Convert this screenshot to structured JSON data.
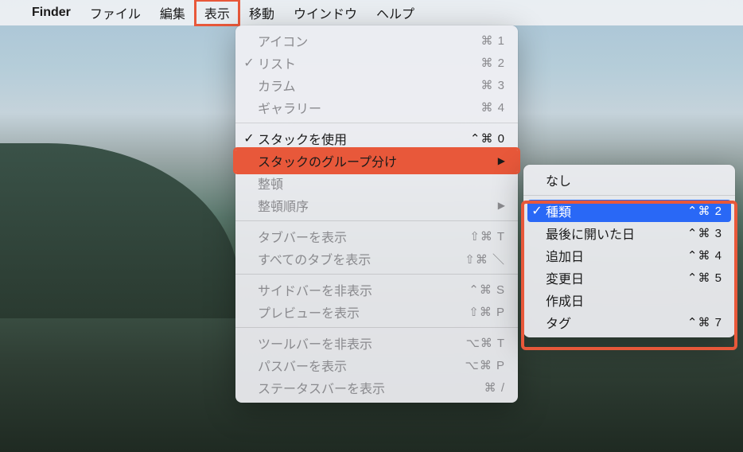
{
  "menubar": {
    "app_name": "Finder",
    "items": [
      "ファイル",
      "編集",
      "表示",
      "移動",
      "ウインドウ",
      "ヘルプ"
    ],
    "highlighted_index": 2
  },
  "view_menu": {
    "items": [
      {
        "label": "アイコン",
        "shortcut": "⌘ 1",
        "check": "",
        "active": false,
        "has_arrow": false
      },
      {
        "label": "リスト",
        "shortcut": "⌘ 2",
        "check": "✓",
        "active": false,
        "has_arrow": false
      },
      {
        "label": "カラム",
        "shortcut": "⌘ 3",
        "check": "",
        "active": false,
        "has_arrow": false
      },
      {
        "label": "ギャラリー",
        "shortcut": "⌘ 4",
        "check": "",
        "active": false,
        "has_arrow": false
      },
      {
        "divider": true
      },
      {
        "label": "スタックを使用",
        "shortcut": "⌃⌘ 0",
        "check": "✓",
        "active": true,
        "has_arrow": false
      },
      {
        "label": "スタックのグループ分け",
        "shortcut": "",
        "check": "",
        "active": true,
        "has_arrow": true,
        "highlighted": true
      },
      {
        "label": "整頓",
        "shortcut": "",
        "check": "",
        "active": false,
        "has_arrow": false
      },
      {
        "label": "整頓順序",
        "shortcut": "",
        "check": "",
        "active": false,
        "has_arrow": true
      },
      {
        "divider": true
      },
      {
        "label": "タブバーを表示",
        "shortcut": "⇧⌘ T",
        "check": "",
        "active": false,
        "has_arrow": false
      },
      {
        "label": "すべてのタブを表示",
        "shortcut": "⇧⌘ ＼",
        "check": "",
        "active": false,
        "has_arrow": false
      },
      {
        "divider": true
      },
      {
        "label": "サイドバーを非表示",
        "shortcut": "⌃⌘ S",
        "check": "",
        "active": false,
        "has_arrow": false
      },
      {
        "label": "プレビューを表示",
        "shortcut": "⇧⌘ P",
        "check": "",
        "active": false,
        "has_arrow": false
      },
      {
        "divider": true
      },
      {
        "label": "ツールバーを非表示",
        "shortcut": "⌥⌘ T",
        "check": "",
        "active": false,
        "has_arrow": false
      },
      {
        "label": "パスバーを表示",
        "shortcut": "⌥⌘ P",
        "check": "",
        "active": false,
        "has_arrow": false
      },
      {
        "label": "ステータスバーを表示",
        "shortcut": "⌘ /",
        "check": "",
        "active": false,
        "has_arrow": false
      }
    ]
  },
  "submenu": {
    "items": [
      {
        "label": "なし",
        "shortcut": "",
        "check": "",
        "selected": false
      },
      {
        "divider": true
      },
      {
        "label": "種類",
        "shortcut": "⌃⌘ 2",
        "check": "✓",
        "selected": true
      },
      {
        "label": "最後に開いた日",
        "shortcut": "⌃⌘ 3",
        "check": "",
        "selected": false
      },
      {
        "label": "追加日",
        "shortcut": "⌃⌘ 4",
        "check": "",
        "selected": false
      },
      {
        "label": "変更日",
        "shortcut": "⌃⌘ 5",
        "check": "",
        "selected": false
      },
      {
        "label": "作成日",
        "shortcut": "",
        "check": "",
        "selected": false
      },
      {
        "label": "タグ",
        "shortcut": "⌃⌘ 7",
        "check": "",
        "selected": false
      }
    ]
  }
}
